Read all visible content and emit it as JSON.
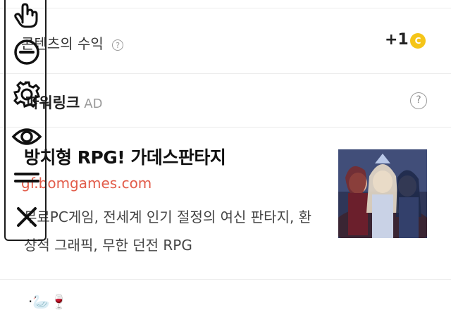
{
  "content_earnings": {
    "label": "콘텐츠의 수익",
    "help": "?",
    "value": "+1",
    "coin_symbol": "C"
  },
  "power_link": {
    "title": "파워링크",
    "ad_badge": "AD",
    "help": "?"
  },
  "ad": {
    "headline": "방치형 RPG! 가데스판타지",
    "url": "gf.bomgames.com",
    "description": "무료PC게임, 전세계 인기 절정의 여신 판타지, 환상적 그래픽, 무한 던전 RPG"
  },
  "bottom_row": {
    "emoji": "·🦢🍷"
  },
  "toolbar": {
    "tools": [
      "hand-pointer-icon",
      "minus-circle-icon",
      "gear-icon",
      "eye-icon",
      "menu-lines-icon",
      "close-icon"
    ]
  },
  "colors": {
    "accent_url": "#e25c4a",
    "coin": "#f5c518",
    "divider": "#ececec"
  }
}
